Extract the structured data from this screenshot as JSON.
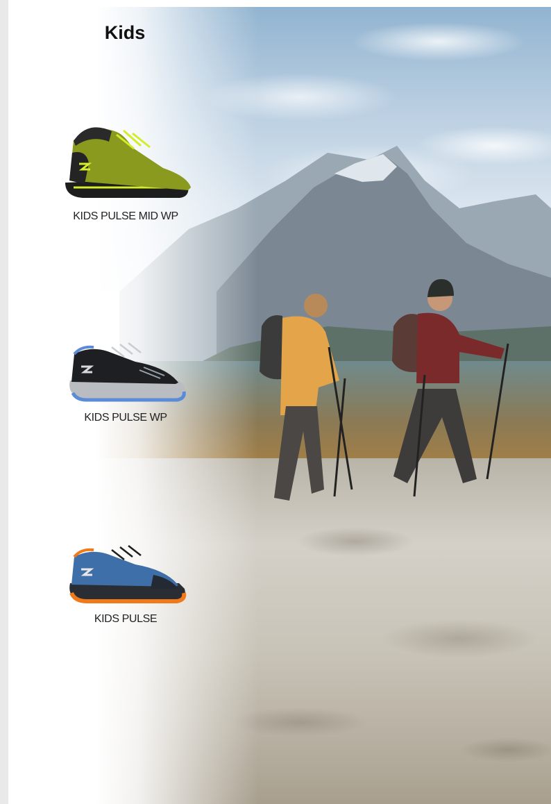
{
  "page": {
    "title": "Kids"
  },
  "products": [
    {
      "name": "KIDS PULSE MID WP",
      "icon": "hiking-boot-mid-icon",
      "colors": {
        "upper": "#8a9a1e",
        "accent": "#d4ec2a",
        "sole": "#1d1d1d"
      }
    },
    {
      "name": "KIDS PULSE WP",
      "icon": "hiking-shoe-icon",
      "colors": {
        "upper": "#1e1f22",
        "accent": "#5b8bd6",
        "sole": "#b9bcc0"
      }
    },
    {
      "name": "KIDS PULSE",
      "icon": "hiking-shoe-icon",
      "colors": {
        "upper": "#3f6fa8",
        "accent": "#f07a1a",
        "sole": "#2a2d33"
      }
    }
  ]
}
